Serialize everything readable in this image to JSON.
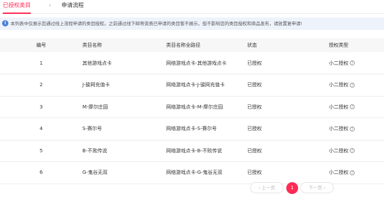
{
  "tabs": {
    "active": "已授权类目",
    "separator": "›",
    "other": "申请流程"
  },
  "notice": {
    "icon": "info-icon",
    "icon_glyph": "i",
    "text": "本列表中仅展示您通过线上流程申请的类目授权。之前通过线下邮寄资质已申请的类目暂不展示，但不影响您的类目授权和商品发布，请放置复申请!"
  },
  "table": {
    "headers": [
      "编号",
      "类目名称",
      "类目名称全路径",
      "状态",
      "授权类型"
    ],
    "rows": [
      {
        "no": "1",
        "name": "其他游戏点卡",
        "path": "网络游戏点卡-其他游戏点卡",
        "status": "已授权",
        "type": "小二授权"
      },
      {
        "no": "2",
        "name": "J-骏网充值卡",
        "path": "网络游戏点卡-J-骏网充值卡",
        "status": "已授权",
        "type": "小二授权"
      },
      {
        "no": "3",
        "name": "M-摩尔庄园",
        "path": "网络游戏点卡-M-摩尔庄园",
        "status": "已授权",
        "type": "小二授权"
      },
      {
        "no": "4",
        "name": "S-赛尔号",
        "path": "网络游戏点卡-S-赛尔号",
        "status": "已授权",
        "type": "小二授权"
      },
      {
        "no": "5",
        "name": "B-不败传说",
        "path": "网络游戏点卡-B-不败传说",
        "status": "已授权",
        "type": "小二授权"
      },
      {
        "no": "6",
        "name": "G-鬼谷无双",
        "path": "网络游戏点卡-G-鬼谷无双",
        "status": "已授权",
        "type": "小二授权"
      }
    ],
    "help_icon": "question-circle-icon",
    "help_glyph": "?"
  },
  "pagination": {
    "prev": "‹ 上一页",
    "current": "1",
    "next": "下一页 ›"
  },
  "colors": {
    "accent": "#ff2c55",
    "info": "#4a7fd3",
    "notice_bg": "#eef3fb"
  }
}
